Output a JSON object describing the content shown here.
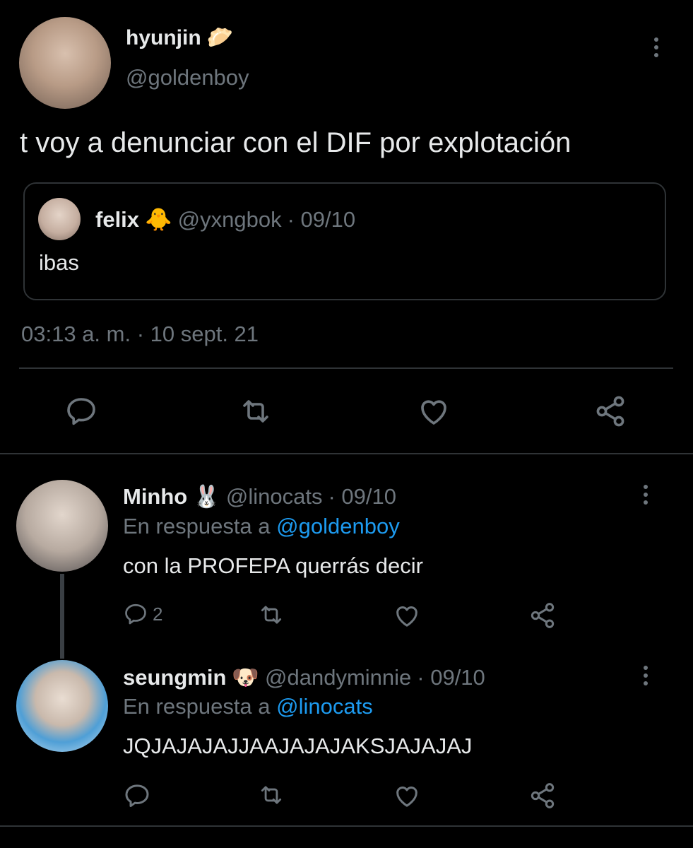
{
  "main_tweet": {
    "author_name": "hyunjin",
    "author_emoji": "🥟",
    "handle": "@goldenboy",
    "text": "t voy a denunciar con el DIF por explotación",
    "timestamp": "03:13 a. m. · 10 sept. 21",
    "quoted": {
      "author_name": "felix",
      "author_emoji": "🐥",
      "handle": "@yxngbok",
      "date": "· 09/10",
      "text": "ibas"
    }
  },
  "replies": [
    {
      "author_name": "Minho",
      "author_emoji": "🐰",
      "handle": "@linocats",
      "date": "· 09/10",
      "reply_prefix": "En respuesta a",
      "reply_to": "@goldenboy",
      "text": "con la PROFEPA querrás decir",
      "reply_count": "2"
    },
    {
      "author_name": "seungmin",
      "author_emoji": "🐶",
      "handle": "@dandyminnie",
      "date": "· 09/10",
      "reply_prefix": "En respuesta a",
      "reply_to": "@linocats",
      "text": "JQJAJAJAJJAAJAJAJAKSJAJAJAJ",
      "reply_count": ""
    }
  ],
  "colors": {
    "background": "#000000",
    "text": "#e7e9ea",
    "muted": "#6e767d",
    "link": "#1d9bf0",
    "divider": "#2f3336"
  },
  "icons": [
    "reply-icon",
    "retweet-icon",
    "like-icon",
    "share-icon",
    "more-icon"
  ]
}
